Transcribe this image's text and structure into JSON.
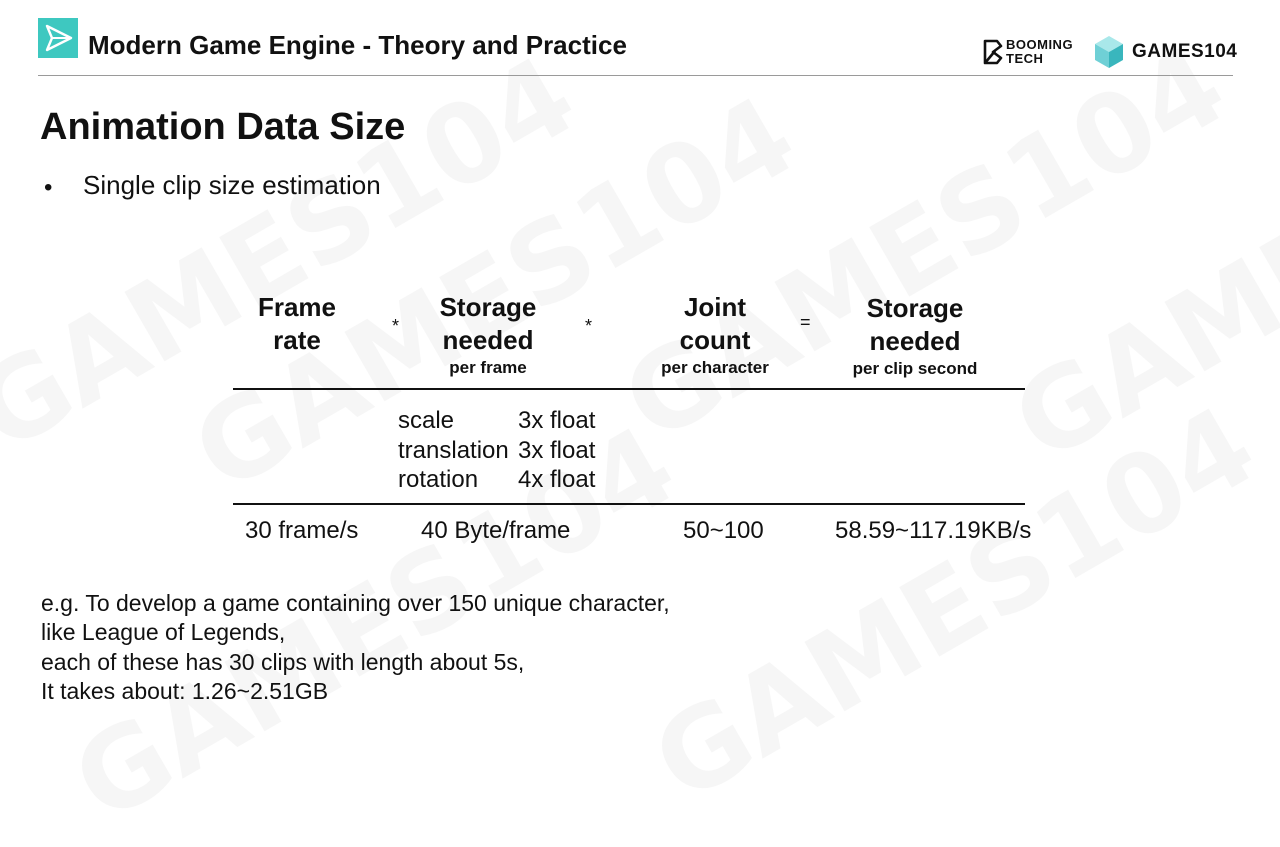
{
  "header": {
    "course_title": "Modern Game Engine - Theory and Practice",
    "booming_line1": "BOOMING",
    "booming_line2": "TECH",
    "games_label": "GAMES104",
    "accent_color": "#3ec8c0"
  },
  "slide": {
    "title": "Animation Data Size",
    "bullet": "Single clip size estimation"
  },
  "table": {
    "columns": [
      {
        "heading_line1": "Frame",
        "heading_line2": "rate",
        "sub": ""
      },
      {
        "heading_line1": "Storage",
        "heading_line2": "needed",
        "sub": "per frame"
      },
      {
        "heading_line1": "Joint",
        "heading_line2": "count",
        "sub": "per character"
      },
      {
        "heading_line1": "Storage",
        "heading_line2": "needed",
        "sub": "per clip second"
      }
    ],
    "operators": [
      "*",
      "*",
      "="
    ],
    "components": [
      {
        "name": "scale",
        "size": "3x float"
      },
      {
        "name": "translation",
        "size": "3x float"
      },
      {
        "name": "rotation",
        "size": "4x float"
      }
    ],
    "results": [
      "30 frame/s",
      "40 Byte/frame",
      "50~100",
      "58.59~117.19KB/s"
    ]
  },
  "notes": [
    "e.g. To develop a game containing over 150 unique character,",
    "like League of Legends,",
    "each of these has 30 clips with length about 5s,",
    "It takes about: 1.26~2.51GB"
  ],
  "watermark": "GAMES104"
}
